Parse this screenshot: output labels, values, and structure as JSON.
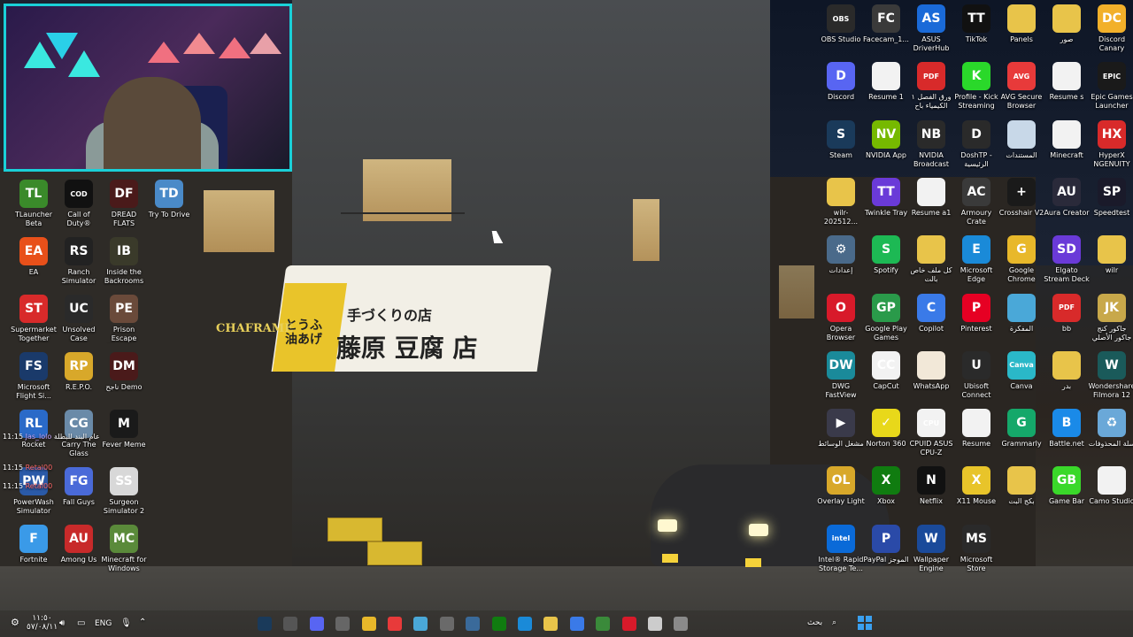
{
  "wallpaper": {
    "shop_sign_small": "手づくりの店",
    "shop_sign_main": "藤原 豆腐 店",
    "shop_sign_yellow": "とうふ 油あげ",
    "left_sign": "CHAFRAME",
    "left_sign_small": "Au"
  },
  "left_icons": [
    {
      "label": "TLauncher Beta",
      "color": "#3a8a2a",
      "glyph": "TL",
      "icon": "minecraft-grass-icon"
    },
    {
      "label": "Call of Duty®",
      "color": "#111111",
      "glyph": "COD",
      "icon": "call-of-duty-icon"
    },
    {
      "label": "DREAD FLATS",
      "color": "#4a1a1a",
      "glyph": "DF",
      "icon": "dread-flats-icon"
    },
    {
      "label": "Try To Drive",
      "color": "#4a8ac8",
      "glyph": "TD",
      "icon": "try-to-drive-icon"
    },
    {
      "label": "EA",
      "color": "#e8501a",
      "glyph": "EA",
      "icon": "ea-icon"
    },
    {
      "label": "Ranch Simulator",
      "color": "#222222",
      "glyph": "RS",
      "icon": "ranch-simulator-icon"
    },
    {
      "label": "Inside the Backrooms",
      "color": "#3a3a2a",
      "glyph": "IB",
      "icon": "backrooms-icon"
    },
    {
      "label": "Supermarket Together",
      "color": "#d82a2a",
      "glyph": "ST",
      "icon": "supermarket-icon"
    },
    {
      "label": "Unsolved Case",
      "color": "#2a2a2a",
      "glyph": "UC",
      "icon": "unsolved-case-icon"
    },
    {
      "label": "Prison Escape Simulator D...",
      "color": "#6a4a3a",
      "glyph": "PE",
      "icon": "prison-escape-icon"
    },
    {
      "label": "Microsoft Flight Si...",
      "color": "#1a3a6a",
      "glyph": "FS",
      "icon": "flight-simulator-icon"
    },
    {
      "label": "R.E.P.O.",
      "color": "#d8a82a",
      "glyph": "RP",
      "icon": "repo-icon"
    },
    {
      "label": "ناجح Demo",
      "color": "#4a1a1a",
      "glyph": "DM",
      "icon": "demo-game-icon"
    },
    {
      "label": "Rocket",
      "color": "#2a6ac8",
      "glyph": "RL",
      "icon": "rocket-league-icon"
    },
    {
      "label": "Carry The Glass",
      "color": "#6a8aa8",
      "glyph": "CG",
      "icon": "carry-glass-icon"
    },
    {
      "label": "Fever Meme",
      "color": "#1a1a1a",
      "glyph": "M",
      "icon": "fever-meme-icon"
    },
    {
      "label": "PowerWash Simulator",
      "color": "#2a5aa8",
      "glyph": "PW",
      "icon": "powerwash-icon"
    },
    {
      "label": "Fall Guys",
      "color": "#4a6ad8",
      "glyph": "FG",
      "icon": "fall-guys-icon"
    },
    {
      "label": "Surgeon Simulator 2",
      "color": "#d8d8d8",
      "glyph": "SS",
      "icon": "surgeon-simulator-icon"
    },
    {
      "label": "Fortnite",
      "color": "#3a9ae8",
      "glyph": "F",
      "icon": "fortnite-icon"
    },
    {
      "label": "Among Us",
      "color": "#c82a2a",
      "glyph": "AU",
      "icon": "among-us-icon"
    },
    {
      "label": "Minecraft for Windows",
      "color": "#5a8a3a",
      "glyph": "MC",
      "icon": "minecraft-icon"
    }
  ],
  "right_icons": [
    {
      "label": "OBS Studio",
      "color": "#2a2a2a",
      "glyph": "OBS",
      "icon": "obs-icon"
    },
    {
      "label": "Facecam_1...",
      "color": "#3a3a3a",
      "glyph": "FC",
      "icon": "video-file-icon"
    },
    {
      "label": "ASUS DriverHub",
      "color": "#1a6ad8",
      "glyph": "AS",
      "icon": "asus-gear-icon"
    },
    {
      "label": "TikTok",
      "color": "#111111",
      "glyph": "TT",
      "icon": "tiktok-icon"
    },
    {
      "label": "Panels",
      "color": "#e8c44a",
      "glyph": "",
      "icon": "folder-icon"
    },
    {
      "label": "صور",
      "color": "#e8c44a",
      "glyph": "",
      "icon": "folder-icon"
    },
    {
      "label": "Discord Canary",
      "color": "#f2b02a",
      "glyph": "DC",
      "icon": "discord-canary-icon"
    },
    {
      "label": "Discord",
      "color": "#5865f2",
      "glyph": "D",
      "icon": "discord-icon"
    },
    {
      "label": "Resume 1",
      "color": "#f2f2f2",
      "glyph": "",
      "icon": "document-icon"
    },
    {
      "label": "ورق الفصل ١ الكيمياء باح",
      "color": "#d82a2a",
      "glyph": "PDF",
      "icon": "pdf-icon"
    },
    {
      "label": "Profile - Kick Streaming",
      "color": "#2ad82a",
      "glyph": "K",
      "icon": "kick-icon"
    },
    {
      "label": "AVG Secure Browser",
      "color": "#e83a3a",
      "glyph": "AVG",
      "icon": "avg-browser-icon"
    },
    {
      "label": "Resume s",
      "color": "#f2f2f2",
      "glyph": "",
      "icon": "document-icon"
    },
    {
      "label": "Epic Games Launcher",
      "color": "#1a1a1a",
      "glyph": "EPIC",
      "icon": "epic-games-icon"
    },
    {
      "label": "Steam",
      "color": "#1a3a5a",
      "glyph": "S",
      "icon": "steam-icon"
    },
    {
      "label": "NVIDIA App",
      "color": "#76b900",
      "glyph": "NV",
      "icon": "nvidia-icon"
    },
    {
      "label": "NVIDIA Broadcast",
      "color": "#2a2a2a",
      "glyph": "NB",
      "icon": "nvidia-broadcast-icon"
    },
    {
      "label": "DoshTP - الرئيسية",
      "color": "#2a2a2a",
      "glyph": "D",
      "icon": "doshtp-icon"
    },
    {
      "label": "المستندات",
      "color": "#c8d8e8",
      "glyph": "",
      "icon": "documents-folder-icon"
    },
    {
      "label": "Minecraft",
      "color": "#f2f2f2",
      "glyph": "",
      "icon": "document-icon"
    },
    {
      "label": "HyperX NGENUITY",
      "color": "#d82a2a",
      "glyph": "HX",
      "icon": "hyperx-icon"
    },
    {
      "label": "wilr-202512...",
      "color": "#e8c44a",
      "glyph": "",
      "icon": "folder-icon"
    },
    {
      "label": "Twinkle Tray",
      "color": "#6a3ad8",
      "glyph": "TT",
      "icon": "twinkle-tray-icon"
    },
    {
      "label": "Resume a1",
      "color": "#f2f2f2",
      "glyph": "",
      "icon": "document-icon"
    },
    {
      "label": "Armoury Crate",
      "color": "#3a3a3a",
      "glyph": "AC",
      "icon": "armoury-crate-icon"
    },
    {
      "label": "Crosshair V2",
      "color": "#1a1a1a",
      "glyph": "+",
      "icon": "crosshair-icon"
    },
    {
      "label": "Aura Creator",
      "color": "#2a2a3a",
      "glyph": "AU",
      "icon": "aura-creator-icon"
    },
    {
      "label": "Speedtest",
      "color": "#1a1a2a",
      "glyph": "SP",
      "icon": "speedtest-icon"
    },
    {
      "label": "إعدادات",
      "color": "#4a6a8a",
      "glyph": "⚙",
      "icon": "settings-gear-icon"
    },
    {
      "label": "Spotify",
      "color": "#1db954",
      "glyph": "S",
      "icon": "spotify-icon"
    },
    {
      "label": "كل ملف خاص بالت",
      "color": "#e8c44a",
      "glyph": "",
      "icon": "folder-icon"
    },
    {
      "label": "Microsoft Edge",
      "color": "#1a8ad8",
      "glyph": "E",
      "icon": "edge-icon"
    },
    {
      "label": "Google Chrome",
      "color": "#e8b82a",
      "glyph": "G",
      "icon": "chrome-icon"
    },
    {
      "label": "Elgato Stream Deck",
      "color": "#6a3ad8",
      "glyph": "SD",
      "icon": "stream-deck-icon"
    },
    {
      "label": "wilr",
      "color": "#e8c44a",
      "glyph": "",
      "icon": "folder-icon"
    },
    {
      "label": "Opera Browser",
      "color": "#d81a2a",
      "glyph": "O",
      "icon": "opera-icon"
    },
    {
      "label": "Google Play Games",
      "color": "#2a9a4a",
      "glyph": "GP",
      "icon": "play-games-icon"
    },
    {
      "label": "Copilot",
      "color": "#3a7ae8",
      "glyph": "C",
      "icon": "copilot-icon"
    },
    {
      "label": "Pinterest",
      "color": "#e60023",
      "glyph": "P",
      "icon": "pinterest-icon"
    },
    {
      "label": "المفكرة",
      "color": "#4aa8d8",
      "glyph": "",
      "icon": "notepad-icon"
    },
    {
      "label": "bb",
      "color": "#d82a2a",
      "glyph": "PDF",
      "icon": "pdf-icon"
    },
    {
      "label": "جاكور كنج جاكور الأصلي",
      "color": "#c8a84a",
      "glyph": "JK",
      "icon": "game-icon"
    },
    {
      "label": "DWG FastView",
      "color": "#1a8a9a",
      "glyph": "DW",
      "icon": "dwg-icon"
    },
    {
      "label": "CapCut",
      "color": "#f2f2f2",
      "glyph": "CC",
      "icon": "capcut-icon"
    },
    {
      "label": "WhatsApp",
      "color": "#f2e8d8",
      "glyph": "",
      "icon": "document-icon"
    },
    {
      "label": "Ubisoft Connect",
      "color": "#2a2a2a",
      "glyph": "U",
      "icon": "ubisoft-icon"
    },
    {
      "label": "Canva",
      "color": "#2ab8c8",
      "glyph": "Canva",
      "icon": "canva-icon"
    },
    {
      "label": "بدر",
      "color": "#e8c44a",
      "glyph": "",
      "icon": "folder-icon"
    },
    {
      "label": "Wondershare Filmora 12",
      "color": "#1a5a5a",
      "glyph": "W",
      "icon": "filmora-icon"
    },
    {
      "label": "مشغل الوسائط",
      "color": "#3a3a4a",
      "glyph": "▶",
      "icon": "media-player-icon"
    },
    {
      "label": "Norton 360",
      "color": "#e8d81a",
      "glyph": "✓",
      "icon": "norton-icon"
    },
    {
      "label": "CPUID ASUS CPU-Z",
      "color": "#f2f2f2",
      "glyph": "CPU",
      "icon": "cpuz-icon"
    },
    {
      "label": "Resume",
      "color": "#f2f2f2",
      "glyph": "",
      "icon": "document-icon"
    },
    {
      "label": "Grammarly",
      "color": "#15a86a",
      "glyph": "G",
      "icon": "grammarly-icon"
    },
    {
      "label": "Battle.net",
      "color": "#1a8ae8",
      "glyph": "B",
      "icon": "battlenet-icon"
    },
    {
      "label": "سلة المحذوفات",
      "color": "#6aa8d8",
      "glyph": "♻",
      "icon": "recycle-bin-icon"
    },
    {
      "label": "Overlay Light",
      "color": "#d8a82a",
      "glyph": "OL",
      "icon": "overlay-light-icon"
    },
    {
      "label": "Xbox",
      "color": "#107c10",
      "glyph": "X",
      "icon": "xbox-icon"
    },
    {
      "label": "Netflix",
      "color": "#111111",
      "glyph": "N",
      "icon": "netflix-icon"
    },
    {
      "label": "X11 Mouse",
      "color": "#e8c42a",
      "glyph": "X",
      "icon": "x11-mouse-icon"
    },
    {
      "label": "بكج البت",
      "color": "#e8c44a",
      "glyph": "",
      "icon": "folder-icon"
    },
    {
      "label": "Game Bar",
      "color": "#3ad82a",
      "glyph": "GB",
      "icon": "game-bar-icon"
    },
    {
      "label": "Camo Studio",
      "color": "#f2f2f2",
      "glyph": "",
      "icon": "document-icon"
    },
    {
      "label": "Intel® Rapid Storage Te...",
      "color": "#0a6ad8",
      "glyph": "intel",
      "icon": "intel-icon"
    },
    {
      "label": "PayPal الموجز",
      "color": "#2a4aa8",
      "glyph": "P",
      "icon": "paypal-icon"
    },
    {
      "label": "Wallpaper Engine",
      "color": "#1a4a9a",
      "glyph": "W",
      "icon": "wallpaper-engine-icon"
    },
    {
      "label": "Microsoft Store",
      "color": "#2a2a2a",
      "glyph": "MS",
      "icon": "microsoft-store-icon"
    }
  ],
  "chat": [
    {
      "time": "11:15",
      "user": "Jas_lolo",
      "msg": "عام البند للبطلة"
    },
    {
      "time": "11:15",
      "user": "Retal00",
      "msg": ""
    },
    {
      "time": "11:15",
      "user": "Retal00",
      "msg": ""
    }
  ],
  "taskbar": {
    "search_placeholder": "بحث",
    "language": "ENG",
    "time": "١١:٥٠",
    "date": "٥٧/٠٨/١١",
    "apps": [
      {
        "name": "steam-task",
        "color": "#1a3a5a"
      },
      {
        "name": "obs-task",
        "color": "#555555"
      },
      {
        "name": "discord-task",
        "color": "#5865f2"
      },
      {
        "name": "task-view",
        "color": "#666666"
      },
      {
        "name": "chrome-task",
        "color": "#e8b82a"
      },
      {
        "name": "avg-task",
        "color": "#e83a3a"
      },
      {
        "name": "pictures-task",
        "color": "#4aa8d8"
      },
      {
        "name": "settings-task",
        "color": "#6a6a6a"
      },
      {
        "name": "armoury-task",
        "color": "#3a6a9a"
      },
      {
        "name": "xbox-task",
        "color": "#107c10"
      },
      {
        "name": "edge-task",
        "color": "#1a8ad8"
      },
      {
        "name": "explorer-task",
        "color": "#e8c44a"
      },
      {
        "name": "copilot-task",
        "color": "#3a7ae8"
      },
      {
        "name": "app-task",
        "color": "#3a8a3a"
      },
      {
        "name": "opera-task",
        "color": "#d81a2a"
      },
      {
        "name": "file-task",
        "color": "#cccccc"
      },
      {
        "name": "app2-task",
        "color": "#8a8a8a"
      }
    ]
  }
}
